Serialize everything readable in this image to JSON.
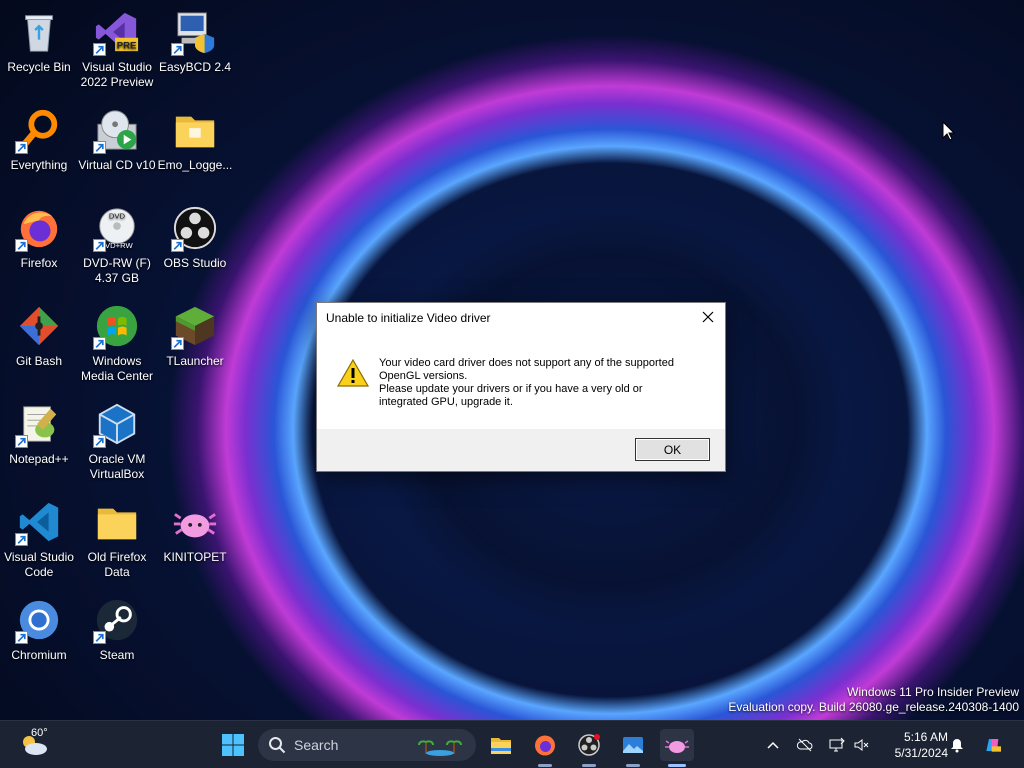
{
  "desktop": {
    "icons": [
      {
        "label": "Recycle Bin"
      },
      {
        "label": "Visual Studio 2022 Preview"
      },
      {
        "label": "EasyBCD 2.4"
      },
      {
        "label": "Everything"
      },
      {
        "label": "Virtual CD v10"
      },
      {
        "label": "Emo_Logge..."
      },
      {
        "label": "Firefox"
      },
      {
        "label": "DVD-RW (F) 4.37 GB"
      },
      {
        "label": "OBS Studio"
      },
      {
        "label": "Git Bash"
      },
      {
        "label": "Windows Media Center"
      },
      {
        "label": "TLauncher"
      },
      {
        "label": "Notepad++"
      },
      {
        "label": "Oracle VM VirtualBox"
      },
      {
        "label": "Visual Studio Code"
      },
      {
        "label": "Old Firefox Data"
      },
      {
        "label": "KINITOPET"
      },
      {
        "label": "Chromium"
      },
      {
        "label": "Steam"
      }
    ],
    "badge_pre": "PRE",
    "dvd_text": "DVD",
    "dvd_rw": "VD+RW",
    "watermark_line1": "Windows 11 Pro Insider Preview",
    "watermark_line2": "Evaluation copy. Build 26080.ge_release.240308-1400"
  },
  "dialog": {
    "title": "Unable to initialize Video driver",
    "message_line1": "Your video card driver does not support any of the supported",
    "message_line2": "OpenGL versions.",
    "message_line3": "Please update your drivers or if you have a very old or",
    "message_line4": "integrated GPU, upgrade it.",
    "ok_label": "OK"
  },
  "taskbar": {
    "weather_temp": "60°",
    "search_placeholder": "Search",
    "clock_time": "5:16 AM",
    "clock_date": "5/31/2024"
  },
  "colors": {
    "accent": "#0078d4",
    "taskbar_bg": "#1c2333"
  }
}
